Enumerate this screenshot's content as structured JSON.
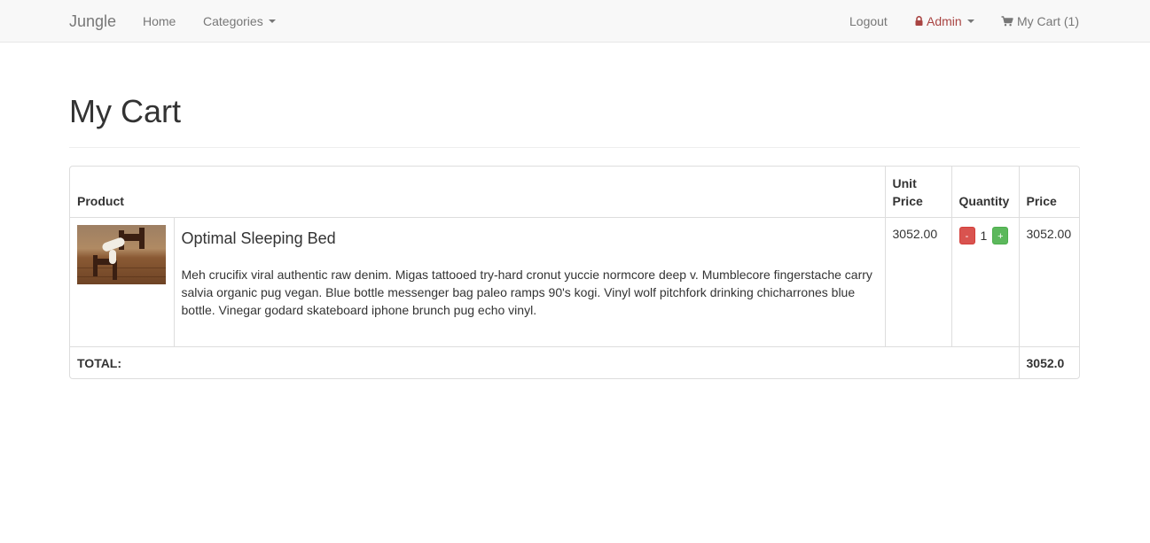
{
  "navbar": {
    "brand": "Jungle",
    "home": "Home",
    "categories": "Categories",
    "logout": "Logout",
    "admin": "Admin",
    "cart": "My Cart (1)",
    "icons": {
      "lock": "lock-icon",
      "cart": "shopping-cart-icon"
    },
    "colors": {
      "admin": "#a94442",
      "text": "#777777",
      "background": "#f8f8f8"
    }
  },
  "page": {
    "title": "My Cart"
  },
  "table": {
    "headers": {
      "product": "Product",
      "unit_price": "Unit Price",
      "quantity": "Quantity",
      "price": "Price"
    },
    "rows": [
      {
        "name": "Optimal Sleeping Bed",
        "description": "Meh crucifix viral authentic raw denim. Migas tattooed try-hard cronut yuccie normcore deep v. Mumblecore fingerstache carry salvia organic pug vegan. Blue bottle messenger bag paleo ramps 90's kogi. Vinyl wolf pitchfork drinking chicharrones blue bottle. Vinegar godard skateboard iphone brunch pug echo vinyl.",
        "unit_price": "3052.00",
        "quantity": "1",
        "minus_label": "-",
        "plus_label": "+",
        "price": "3052.00"
      }
    ],
    "footer": {
      "label": "TOTAL:",
      "total": "3052.0"
    }
  },
  "colors": {
    "minus_button": "#d9534f",
    "plus_button": "#5cb85c"
  }
}
